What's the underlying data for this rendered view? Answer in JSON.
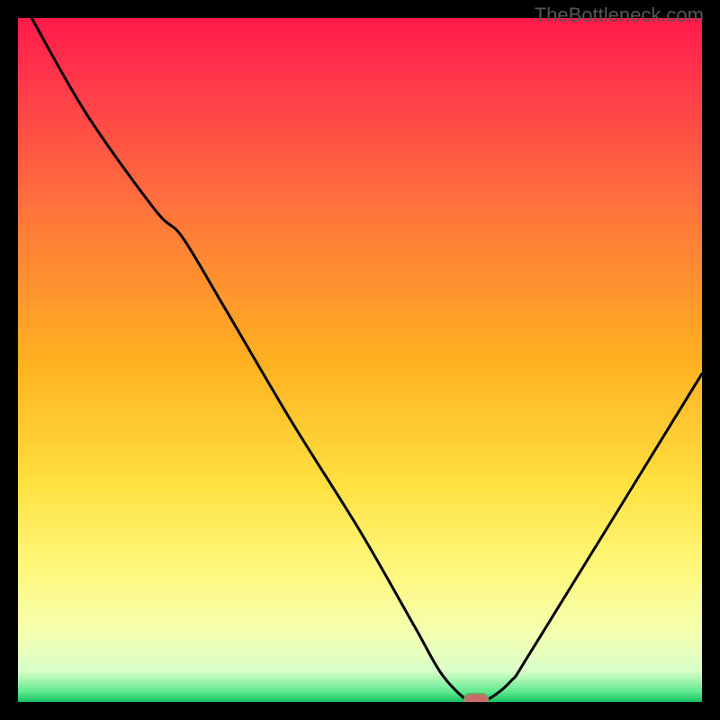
{
  "watermark": "TheBottleneck.com",
  "chart_data": {
    "type": "line",
    "title": "",
    "xlabel": "",
    "ylabel": "",
    "xlim": [
      0,
      100
    ],
    "ylim": [
      0,
      100
    ],
    "series": [
      {
        "name": "bottleneck-curve",
        "x": [
          2,
          10,
          20,
          24,
          30,
          40,
          50,
          58,
          62,
          66,
          68,
          72,
          76,
          100
        ],
        "values": [
          100,
          86,
          72,
          68,
          58,
          41,
          25,
          11,
          4,
          0,
          0,
          3,
          9,
          48
        ]
      }
    ],
    "annotations": [
      {
        "name": "optimal-marker",
        "x": 67,
        "y": 0
      }
    ],
    "gradient_stops": [
      {
        "offset": 0.0,
        "color": "#ff1a4a"
      },
      {
        "offset": 0.1,
        "color": "#ff3a4a"
      },
      {
        "offset": 0.3,
        "color": "#ff7a3a"
      },
      {
        "offset": 0.5,
        "color": "#ffb020"
      },
      {
        "offset": 0.68,
        "color": "#ffe040"
      },
      {
        "offset": 0.8,
        "color": "#fff77a"
      },
      {
        "offset": 0.9,
        "color": "#f4ffb0"
      },
      {
        "offset": 0.955,
        "color": "#d8ffc8"
      },
      {
        "offset": 0.985,
        "color": "#60e890"
      },
      {
        "offset": 1.0,
        "color": "#18c060"
      }
    ],
    "marker": {
      "fill": "#c96a6a",
      "stroke": "#7aa060"
    }
  }
}
